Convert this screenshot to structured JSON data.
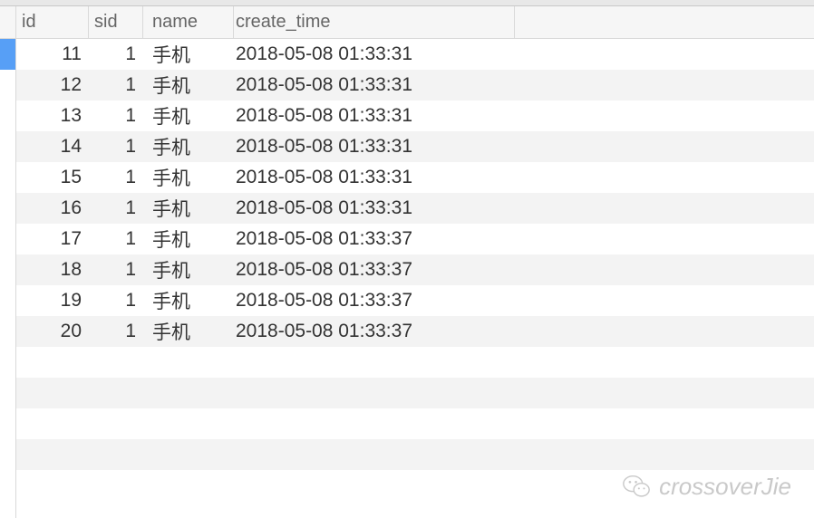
{
  "columns": {
    "id": "id",
    "sid": "sid",
    "name": "name",
    "create_time": "create_time"
  },
  "rows": [
    {
      "id": "11",
      "sid": "1",
      "name": "手机",
      "create_time": "2018-05-08 01:33:31"
    },
    {
      "id": "12",
      "sid": "1",
      "name": "手机",
      "create_time": "2018-05-08 01:33:31"
    },
    {
      "id": "13",
      "sid": "1",
      "name": "手机",
      "create_time": "2018-05-08 01:33:31"
    },
    {
      "id": "14",
      "sid": "1",
      "name": "手机",
      "create_time": "2018-05-08 01:33:31"
    },
    {
      "id": "15",
      "sid": "1",
      "name": "手机",
      "create_time": "2018-05-08 01:33:31"
    },
    {
      "id": "16",
      "sid": "1",
      "name": "手机",
      "create_time": "2018-05-08 01:33:31"
    },
    {
      "id": "17",
      "sid": "1",
      "name": "手机",
      "create_time": "2018-05-08 01:33:37"
    },
    {
      "id": "18",
      "sid": "1",
      "name": "手机",
      "create_time": "2018-05-08 01:33:37"
    },
    {
      "id": "19",
      "sid": "1",
      "name": "手机",
      "create_time": "2018-05-08 01:33:37"
    },
    {
      "id": "20",
      "sid": "1",
      "name": "手机",
      "create_time": "2018-05-08 01:33:37"
    }
  ],
  "empty_rows": 5,
  "active_row_index": 0,
  "watermark": "crossoverJie"
}
